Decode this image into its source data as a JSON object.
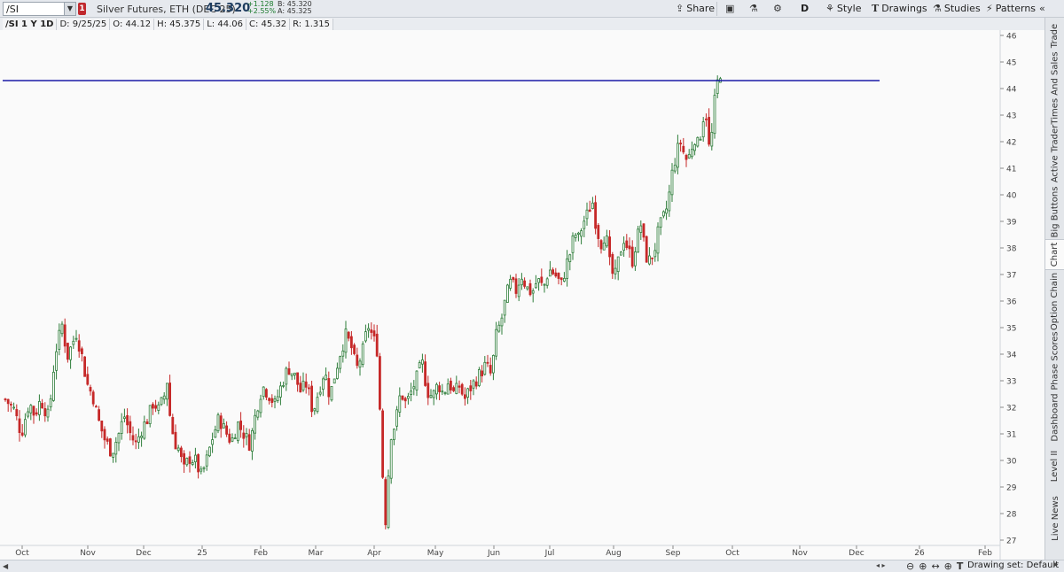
{
  "toolbar": {
    "symbol": "/SI",
    "alert_badge": "1",
    "description": "Silver Futures, ETH (DEC 25)",
    "last_price": "45.320",
    "change_abs": "+1.128",
    "change_pct": "+2.55%",
    "bid": "B: 45.320",
    "ask": "A: 45.325",
    "share_label": "Share",
    "timeframe_label": "D",
    "style_label": "Style",
    "drawings_label": "Drawings",
    "studies_label": "Studies",
    "patterns_label": "Patterns",
    "accent_color": "#1d3b5e",
    "up_color": "#1a7a2c",
    "badge_color": "#c0282d"
  },
  "infobar": {
    "title": "/SI 1 Y 1D",
    "date": "D: 9/25/25",
    "open": "O: 44.12",
    "high": "H: 45.375",
    "low": "L: 44.06",
    "close": "C: 45.32",
    "range": "R: 1.315"
  },
  "sidebar": {
    "tabs": [
      {
        "label": "Trade"
      },
      {
        "label": "Times And Sales"
      },
      {
        "label": "Active Trader"
      },
      {
        "label": "Big Buttons"
      },
      {
        "label": "Chart",
        "active": true
      },
      {
        "label": "Option Chain"
      },
      {
        "label": "Phase Scores"
      },
      {
        "label": "Dashboard"
      },
      {
        "label": "Level II"
      },
      {
        "label": "Live News"
      }
    ]
  },
  "bottombar": {
    "drawing_set": "Drawing set: Default"
  },
  "chart_data": {
    "type": "candlestick",
    "ylim": [
      27,
      46
    ],
    "y_ticks": [
      27,
      28,
      29,
      30,
      31,
      32,
      33,
      34,
      35,
      36,
      37,
      38,
      39,
      40,
      41,
      42,
      43,
      44,
      45,
      46
    ],
    "x_tick_labels": [
      "Oct",
      "Nov",
      "Dec",
      "25",
      "Feb",
      "Mar",
      "Apr",
      "May",
      "Jun",
      "Jul",
      "Aug",
      "Sep",
      "Oct",
      "Nov",
      "Dec",
      "26",
      "Feb"
    ],
    "horizontal_line": {
      "value": 44.3,
      "color": "#1a1aa8"
    },
    "up_color": "#2e7d3a",
    "down_color": "#c62828",
    "close_path": [
      [
        0,
        32.3
      ],
      [
        10,
        31.9
      ],
      [
        18,
        31.0
      ],
      [
        27,
        32.2
      ],
      [
        33,
        31.7
      ],
      [
        40,
        32.3
      ],
      [
        49,
        31.6
      ],
      [
        56,
        34.0
      ],
      [
        64,
        35.1
      ],
      [
        70,
        33.9
      ],
      [
        80,
        34.8
      ],
      [
        86,
        34.0
      ],
      [
        92,
        32.9
      ],
      [
        99,
        32.4
      ],
      [
        104,
        31.6
      ],
      [
        112,
        30.8
      ],
      [
        120,
        30.3
      ],
      [
        128,
        31.0
      ],
      [
        134,
        31.7
      ],
      [
        141,
        31.0
      ],
      [
        147,
        30.6
      ],
      [
        154,
        31.2
      ],
      [
        161,
        31.6
      ],
      [
        167,
        32.2
      ],
      [
        173,
        31.9
      ],
      [
        179,
        32.4
      ],
      [
        183,
        33.1
      ],
      [
        186,
        31.5
      ],
      [
        191,
        30.7
      ],
      [
        196,
        30.4
      ],
      [
        201,
        29.6
      ],
      [
        207,
        30.1
      ],
      [
        214,
        30.0
      ],
      [
        221,
        29.4
      ],
      [
        227,
        30.0
      ],
      [
        234,
        30.9
      ],
      [
        241,
        31.6
      ],
      [
        248,
        31.1
      ],
      [
        255,
        30.7
      ],
      [
        262,
        31.4
      ],
      [
        269,
        31.0
      ],
      [
        276,
        30.6
      ],
      [
        283,
        31.9
      ],
      [
        290,
        32.8
      ],
      [
        297,
        32.5
      ],
      [
        304,
        32.1
      ],
      [
        312,
        32.9
      ],
      [
        319,
        33.5
      ],
      [
        326,
        33.2
      ],
      [
        333,
        32.6
      ],
      [
        340,
        32.9
      ],
      [
        347,
        31.8
      ],
      [
        354,
        32.7
      ],
      [
        360,
        33.4
      ],
      [
        366,
        32.4
      ],
      [
        372,
        33.3
      ],
      [
        378,
        34.1
      ],
      [
        384,
        34.7
      ],
      [
        390,
        34.3
      ],
      [
        396,
        33.4
      ],
      [
        403,
        34.1
      ],
      [
        409,
        35.1
      ],
      [
        415,
        34.6
      ],
      [
        421,
        34.0
      ],
      [
        424,
        29.6
      ],
      [
        427,
        29.3
      ],
      [
        429,
        27.6
      ],
      [
        432,
        29.5
      ],
      [
        435,
        31.0
      ],
      [
        440,
        31.4
      ],
      [
        446,
        32.6
      ],
      [
        452,
        32.1
      ],
      [
        458,
        32.6
      ],
      [
        464,
        33.1
      ],
      [
        470,
        33.7
      ],
      [
        476,
        32.6
      ],
      [
        482,
        32.4
      ],
      [
        488,
        32.9
      ],
      [
        494,
        32.5
      ],
      [
        500,
        33.0
      ],
      [
        506,
        32.5
      ],
      [
        512,
        32.8
      ],
      [
        518,
        32.3
      ],
      [
        524,
        32.7
      ],
      [
        530,
        33.0
      ],
      [
        536,
        33.3
      ],
      [
        542,
        33.6
      ],
      [
        548,
        33.2
      ],
      [
        554,
        34.8
      ],
      [
        559,
        35.2
      ],
      [
        565,
        36.2
      ],
      [
        570,
        36.7
      ],
      [
        576,
        36.4
      ],
      [
        582,
        37.0
      ],
      [
        588,
        36.5
      ],
      [
        594,
        36.3
      ],
      [
        600,
        36.8
      ],
      [
        607,
        36.5
      ],
      [
        613,
        37.2
      ],
      [
        620,
        37.0
      ],
      [
        627,
        36.6
      ],
      [
        633,
        37.4
      ],
      [
        638,
        37.9
      ],
      [
        642,
        38.6
      ],
      [
        646,
        38.3
      ],
      [
        651,
        38.9
      ],
      [
        657,
        39.3
      ],
      [
        662,
        39.8
      ],
      [
        667,
        38.7
      ],
      [
        672,
        38.2
      ],
      [
        677,
        38.6
      ],
      [
        682,
        37.3
      ],
      [
        687,
        36.8
      ],
      [
        692,
        37.6
      ],
      [
        697,
        38.4
      ],
      [
        702,
        38.0
      ],
      [
        707,
        37.5
      ],
      [
        712,
        38.3
      ],
      [
        717,
        38.9
      ],
      [
        722,
        37.7
      ],
      [
        727,
        37.5
      ],
      [
        732,
        37.9
      ],
      [
        737,
        38.7
      ],
      [
        742,
        39.1
      ],
      [
        747,
        39.6
      ],
      [
        752,
        40.8
      ],
      [
        757,
        41.6
      ],
      [
        762,
        42.0
      ],
      [
        767,
        41.3
      ],
      [
        772,
        41.5
      ],
      [
        777,
        42.2
      ],
      [
        782,
        41.8
      ],
      [
        786,
        42.8
      ],
      [
        790,
        43.2
      ],
      [
        793,
        41.7
      ],
      [
        797,
        42.3
      ],
      [
        800,
        43.5
      ],
      [
        803,
        44.2
      ],
      [
        806,
        44.5
      ],
      [
        809,
        45.3
      ]
    ]
  }
}
